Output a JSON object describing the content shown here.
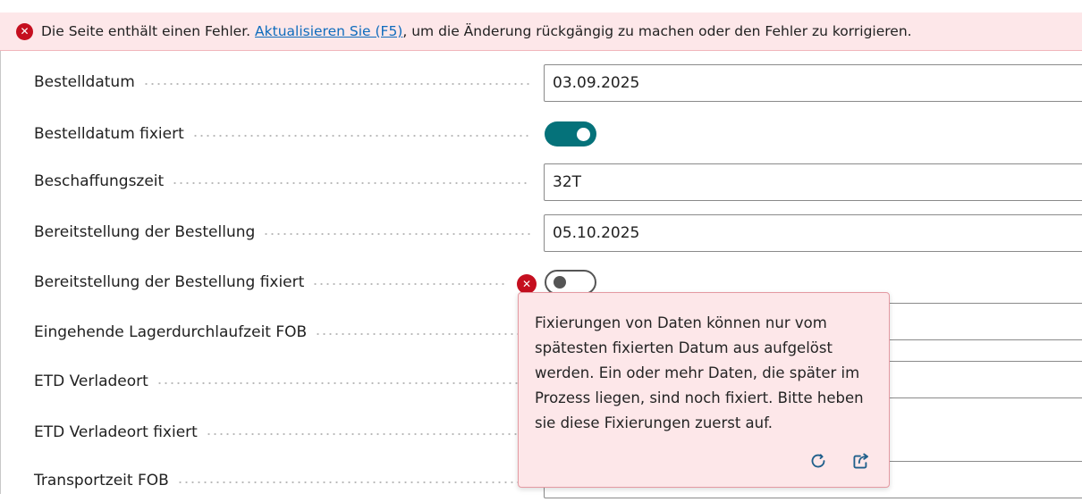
{
  "error_bar": {
    "prefix": "Die Seite enthält einen Fehler.",
    "link": "Aktualisieren Sie (F5)",
    "suffix": ", um die Änderung rückgängig zu machen oder den Fehler zu korrigieren."
  },
  "fields": [
    {
      "label": "Bestelldatum",
      "value": "03.09.2025"
    },
    {
      "label": "Bestelldatum fixiert",
      "toggle": "on"
    },
    {
      "label": "Beschaffungszeit",
      "value": "32T"
    },
    {
      "label": "Bereitstellung der Bestellung",
      "value": "05.10.2025"
    },
    {
      "label": "Bereitstellung der Bestellung fixiert",
      "toggle": "off"
    },
    {
      "label": "Eingehende Lagerdurchlaufzeit FOB"
    },
    {
      "label": "ETD Verladeort"
    },
    {
      "label": "ETD Verladeort fixiert"
    },
    {
      "label": "Transportzeit FOB"
    }
  ],
  "tooltip": {
    "message": "Fixierungen von Daten können nur vom spätesten fixierten Datum aus aufgelöst werden. Ein oder mehr Daten, die später im Prozess liegen, sind noch fixiert. Bitte heben sie diese Fixierungen zuerst auf."
  },
  "colors": {
    "accent": "#05727a",
    "error": "#c50f1f",
    "error_bg": "#fde7e9"
  }
}
